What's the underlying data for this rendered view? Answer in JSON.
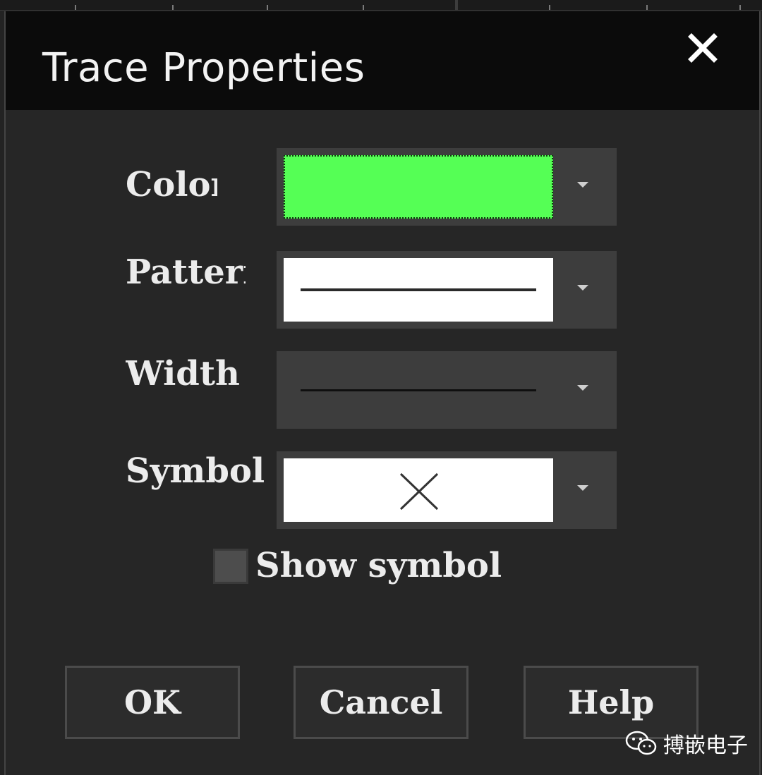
{
  "dialog": {
    "title": "Trace Properties",
    "close_icon": "close-icon"
  },
  "fields": {
    "color": {
      "label": "Color",
      "value_color": "#55ff55"
    },
    "pattern": {
      "label": "Pattern",
      "value": "solid"
    },
    "width": {
      "label": "Width",
      "value": "thin"
    },
    "symbol": {
      "label": "Symbol",
      "value": "cross-x",
      "icon": "x-symbol-icon"
    }
  },
  "show_symbol": {
    "label": "Show symbol",
    "checked": false
  },
  "buttons": {
    "ok": "OK",
    "cancel": "Cancel",
    "help": "Help"
  },
  "watermark": {
    "text": "搏嵌电子",
    "icon": "wechat-icon"
  },
  "colors": {
    "titlebar": "#0b0b0b",
    "dialog_bg": "#262626",
    "combo_bg": "#3d3d3d",
    "accent_green": "#55ff55"
  }
}
